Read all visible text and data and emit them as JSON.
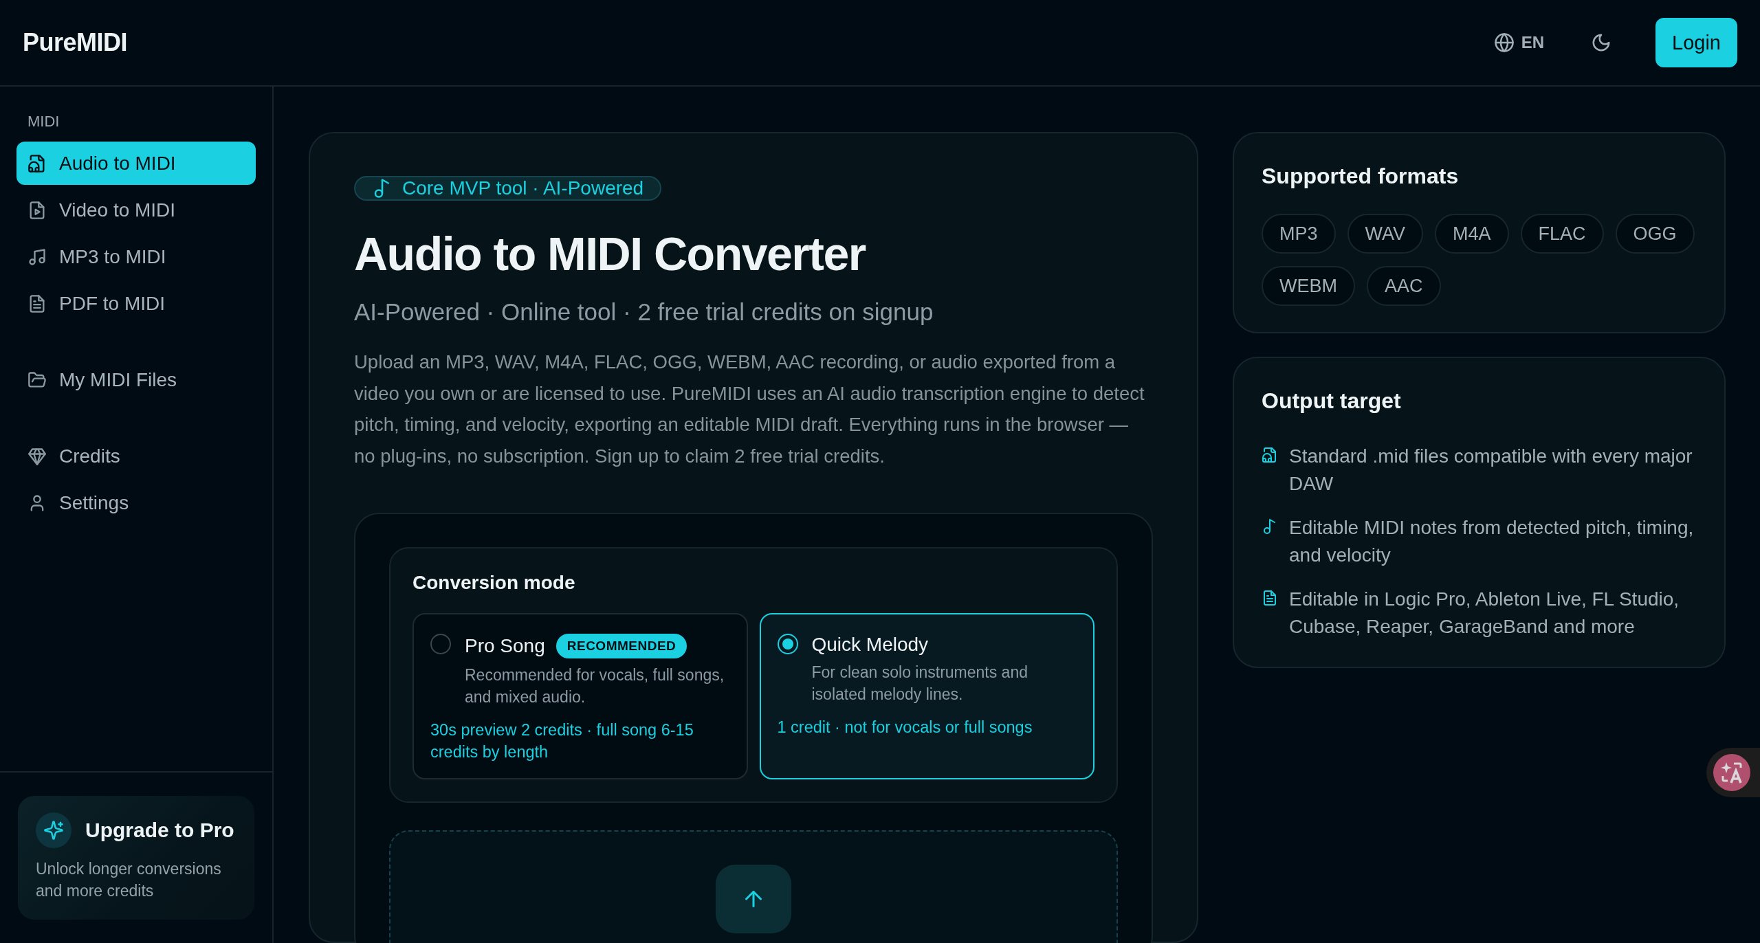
{
  "header": {
    "logo": "PureMIDI",
    "language": "EN",
    "login": "Login"
  },
  "sidebar": {
    "section": "MIDI",
    "groups": [
      {
        "items": [
          {
            "label": "Audio to MIDI",
            "selected": true
          },
          {
            "label": "Video to MIDI",
            "selected": false
          },
          {
            "label": "MP3 to MIDI",
            "selected": false
          },
          {
            "label": "PDF to MIDI",
            "selected": false
          }
        ]
      },
      {
        "items": [
          {
            "label": "My MIDI Files",
            "selected": false
          }
        ]
      },
      {
        "items": [
          {
            "label": "Credits",
            "selected": false
          },
          {
            "label": "Settings",
            "selected": false
          }
        ]
      }
    ],
    "upgrade": {
      "title": "Upgrade to Pro",
      "text": "Unlock longer conversions and more credits"
    }
  },
  "hero": {
    "badge": "Core MVP tool · AI-Powered",
    "title": "Audio to MIDI Converter",
    "subtitle": "AI-Powered · Online tool · 2 free trial credits on signup",
    "description": "Upload an MP3, WAV, M4A, FLAC, OGG, WEBM, AAC recording, or audio exported from a video you own or are licensed to use. PureMIDI uses an AI audio transcription engine to detect pitch, timing, and velocity, exporting an editable MIDI draft. Everything runs in the browser — no plug-ins, no subscription. Sign up to claim 2 free trial credits."
  },
  "conversion_mode": {
    "title": "Conversion mode",
    "options": [
      {
        "name": "Pro Song",
        "badge": "RECOMMENDED",
        "description": "Recommended for vocals, full songs, and mixed audio.",
        "cost": "30s preview 2 credits · full song 6-15 credits by length",
        "selected": false
      },
      {
        "name": "Quick Melody",
        "description": "For clean solo instruments and isolated melody lines.",
        "cost": "1 credit · not for vocals or full songs",
        "selected": true
      }
    ]
  },
  "supported_formats": {
    "title": "Supported formats",
    "formats": [
      "MP3",
      "WAV",
      "M4A",
      "FLAC",
      "OGG",
      "WEBM",
      "AAC"
    ]
  },
  "output_target": {
    "title": "Output target",
    "items": [
      "Standard .mid files compatible with every major DAW",
      "Editable MIDI notes from detected pitch, timing, and velocity",
      "Editable in Logic Pro, Ableton Live, FL Studio, Cubase, Reaper, GarageBand and more"
    ]
  }
}
